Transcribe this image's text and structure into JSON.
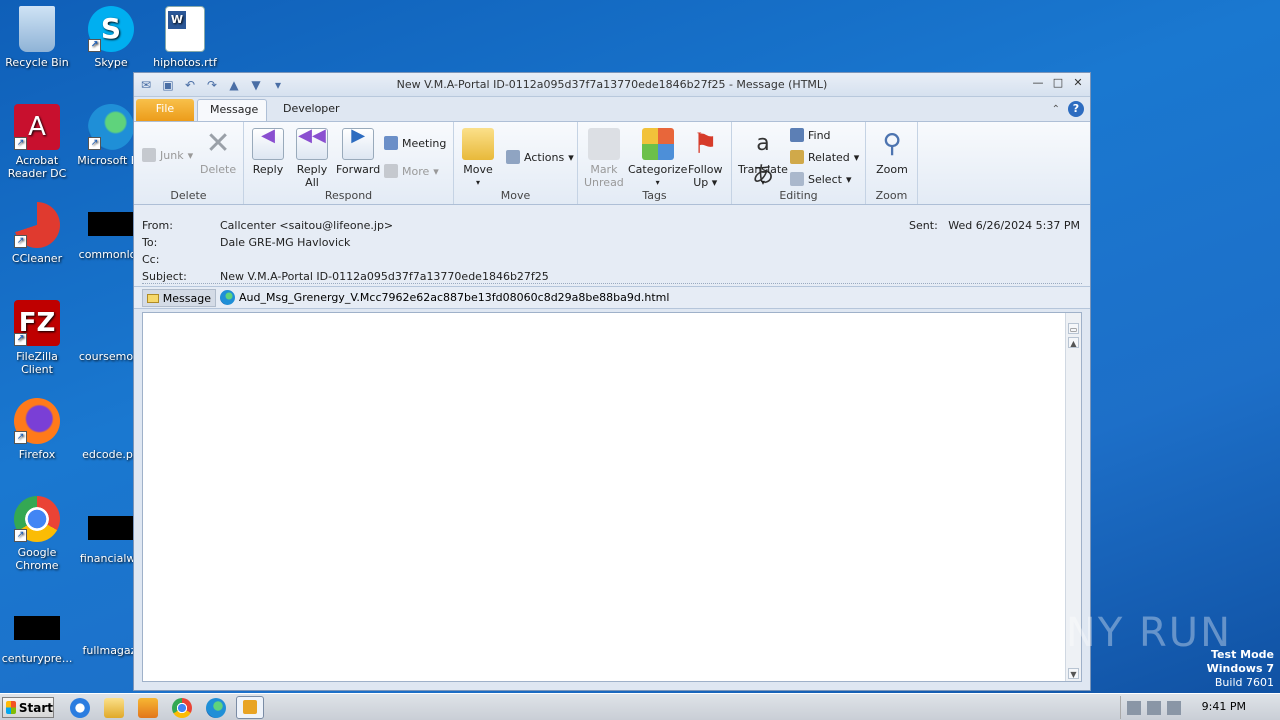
{
  "desktop": {
    "icons": [
      {
        "label": "Recycle Bin"
      },
      {
        "label": "Skype"
      },
      {
        "label": "hiphotos.rtf"
      },
      {
        "label": "Acrobat Reader DC"
      },
      {
        "label": "Microsoft Ed"
      },
      {
        "label": "CCleaner"
      },
      {
        "label": "commonlog"
      },
      {
        "label": "FileZilla Client"
      },
      {
        "label": "coursemoni"
      },
      {
        "label": "Firefox"
      },
      {
        "label": "edcode.pn"
      },
      {
        "label": "Google Chrome"
      },
      {
        "label": "financialwe"
      },
      {
        "label": "centurypre..."
      },
      {
        "label": "fullmagazi"
      }
    ]
  },
  "window": {
    "title": "New V.M.A-Portal ID-0112a095d37f7a13770ede1846b27f25  -  Message (HTML)"
  },
  "tabs": {
    "file": "File",
    "message": "Message",
    "developer": "Developer"
  },
  "ribbon": {
    "delete_group": {
      "label": "Delete",
      "junk": "Junk",
      "delete": "Delete"
    },
    "respond_group": {
      "label": "Respond",
      "reply": "Reply",
      "reply_all_1": "Reply",
      "reply_all_2": "All",
      "forward": "Forward",
      "meeting": "Meeting",
      "more": "More"
    },
    "move_group": {
      "label": "Move",
      "move": "Move",
      "actions": "Actions"
    },
    "tags_group": {
      "label": "Tags",
      "mark_unread_1": "Mark",
      "mark_unread_2": "Unread",
      "categorize": "Categorize",
      "follow_up_1": "Follow",
      "follow_up_2": "Up"
    },
    "editing_group": {
      "label": "Editing",
      "translate": "Translate",
      "find": "Find",
      "related": "Related",
      "select": "Select"
    },
    "zoom_group": {
      "label": "Zoom",
      "zoom": "Zoom"
    }
  },
  "header": {
    "from_label": "From:",
    "from_value": "Callcenter <saitou@lifeone.jp>",
    "to_label": "To:",
    "to_value": "Dale GRE-MG Havlovick",
    "cc_label": "Cc:",
    "cc_value": "",
    "subject_label": "Subject:",
    "subject_value": "New V.M.A-Portal ID-0112a095d37f7a13770ede1846b27f25",
    "sent_label": "Sent:",
    "sent_value": "Wed 6/26/2024 5:37 PM"
  },
  "attachments": {
    "message_tab": "Message",
    "file_name": "Aud_Msg_Grenergy_V.Mcc7962e62ac887be13fd08060c8d29a8be88ba9d.html"
  },
  "taskbar": {
    "start": "Start",
    "clock": "9:41 PM"
  },
  "watermark": {
    "text": "ANY RUN",
    "mode_line1": "Test Mode",
    "mode_line2": "Windows 7",
    "mode_line3": "Build 7601"
  }
}
